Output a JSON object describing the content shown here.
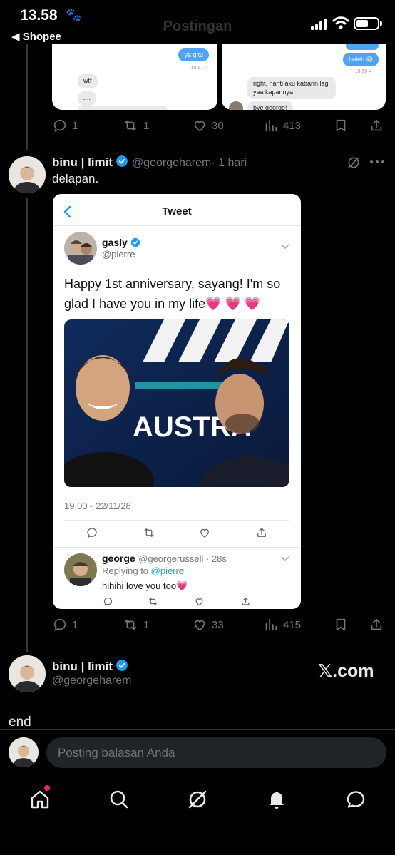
{
  "status_bar": {
    "time": "13.58",
    "back_app": "◀ Shopee",
    "header_title": "Postingan"
  },
  "top_tweet": {
    "left_chat": {
      "out_message": "ya gitu",
      "out_time": "18.57 ✓",
      "in_messages": [
        "wtf",
        "...."
      ]
    },
    "right_chat": {
      "out_message": "boleh 😅",
      "out_time": "18.58 ✓",
      "in_message": "right, nanti aku kabarin lagi yaa kapannya",
      "in_message2": "bye george!"
    },
    "stats": {
      "replies": "1",
      "reposts": "1",
      "likes": "30",
      "views": "413"
    }
  },
  "second_tweet": {
    "author_name": "binu | limit",
    "author_handle": "@georgeharem",
    "time_ago": "· 1 hari",
    "text": "delapan.",
    "stats": {
      "replies": "1",
      "reposts": "1",
      "likes": "33",
      "views": "415"
    },
    "embedded": {
      "header_title": "Tweet",
      "author_name": "gasly",
      "author_handle": "@pierre",
      "text": "Happy 1st anniversary, sayang! I'm so glad I have you in my life💗 💗 💗",
      "photo_banner_text": "AUSTRA",
      "timestamp": "19.00 · 22/11/28",
      "reply": {
        "author_name": "george",
        "author_handle": "@georgerussell · 28s",
        "replying_to_label": "Replying to",
        "replying_to_handle": "@pierre",
        "text": "hihihi love you too💗"
      }
    }
  },
  "third_tweet": {
    "author_name": "binu | limit",
    "author_handle": "@georgeharem",
    "watermark": "𝕏.com",
    "body": "end"
  },
  "reply_bar": {
    "placeholder": "Posting balasan Anda"
  },
  "bottom_nav": {
    "items": [
      "home-icon",
      "search-icon",
      "grok-icon",
      "notifications-icon",
      "messages-icon"
    ]
  },
  "colors": {
    "background": "#000000",
    "accent": "#1d9bf0",
    "secondary_text": "#71767b",
    "notification_dot": "#f91880"
  }
}
